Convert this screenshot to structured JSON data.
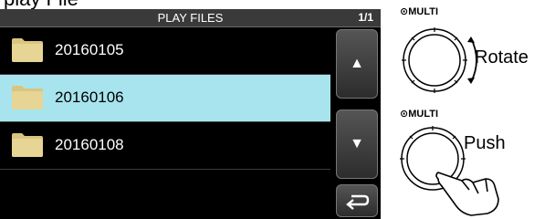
{
  "header_fragment": "play File",
  "screen": {
    "title": "PLAY FILES",
    "page_indicator": "1/1",
    "files": [
      {
        "name": "20160105",
        "selected": false
      },
      {
        "name": "20160106",
        "selected": true
      },
      {
        "name": "20160108",
        "selected": false
      }
    ],
    "buttons": {
      "up_glyph": "▲",
      "down_glyph": "▼",
      "back_glyph": "↵"
    }
  },
  "knob_rotate": {
    "label": "MULTI",
    "action": "Rotate"
  },
  "knob_push": {
    "label": "MULTI",
    "action": "Push"
  },
  "colors": {
    "selected_row": "#a8e4ee",
    "folder": "#e3cf8f"
  }
}
